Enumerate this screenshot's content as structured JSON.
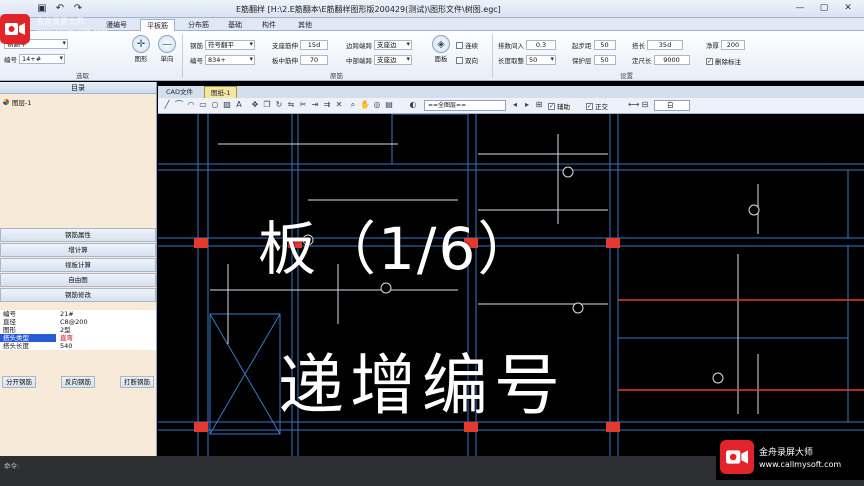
{
  "titlebar": {
    "title": "E筋翻样   [H:\\2.E筋翻本\\E筋翻样图形版200429(测试)\\图形文件\\树图.egc]",
    "win_min": "—",
    "win_max": "▢",
    "win_close": "✕"
  },
  "ribbon_tabs": [
    "漫编号",
    "平板筋",
    "分布筋",
    "基础",
    "构件",
    "其他"
  ],
  "ribbon": {
    "left_fields": [
      {
        "label": "",
        "value": "钢翻平"
      },
      {
        "label": "编号",
        "value": "14+#"
      }
    ],
    "left_buttons": [
      {
        "label": "图形"
      },
      {
        "label": "单向"
      }
    ],
    "mid_fields": [
      {
        "label": "钢筋",
        "value": "符号翻平"
      },
      {
        "label": "编号",
        "value": "834+"
      },
      {
        "label": "支座筋伸",
        "value": "15d"
      },
      {
        "label": "板中筋伸",
        "value": "70"
      },
      {
        "label": "边跨端跨",
        "value": "支座边"
      },
      {
        "label": "中部端跨",
        "value": "支座边"
      }
    ],
    "mid_checks": [
      {
        "label": "连续",
        "checked": false
      },
      {
        "label": "双向",
        "checked": false
      }
    ],
    "right_fields": [
      {
        "label": "排数间入",
        "value": "0.3"
      },
      {
        "label": "起步距",
        "value": "50"
      },
      {
        "label": "搭长",
        "value": "35d"
      },
      {
        "label": "净厚",
        "value": "200"
      },
      {
        "label": "长度取整",
        "value": "50"
      },
      {
        "label": "保护层",
        "value": "50"
      },
      {
        "label": "定尺长",
        "value": "9000"
      }
    ],
    "right_check": {
      "label": "删除标注",
      "checked": true
    },
    "group_labels": [
      "选取",
      "原筋",
      "设置"
    ],
    "round_button": "面板"
  },
  "left_panel": {
    "header": "目录",
    "tree_node": "图层-1",
    "actions": [
      "钢筋属性",
      "增计算",
      "视板计算",
      "自由图",
      "钢筋修改"
    ],
    "props": [
      {
        "key": "编号",
        "value": "21#"
      },
      {
        "key": "直径",
        "value": "C8@200"
      },
      {
        "key": "图形",
        "value": "2型"
      },
      {
        "key": "搭头类型",
        "value": "直弯"
      },
      {
        "key": "搭头长度",
        "value": "540"
      }
    ],
    "bottom_buttons": [
      "分开钢筋",
      "反向钢筋",
      "打断钢筋"
    ]
  },
  "doc_tabs": [
    "CAD文件",
    "图纸-1"
  ],
  "cad_toolbar": {
    "layer": "==全图层==",
    "checks": [
      {
        "label": "辅助",
        "checked": true
      },
      {
        "label": "正交",
        "checked": true
      }
    ],
    "color": "白"
  },
  "caption": {
    "line1": "板（1/6）",
    "line2": "递增编号"
  },
  "watermark": {
    "tl_text": "金舟录屏大师",
    "tl_url": "www.callmysoft.com",
    "br_name": "金舟录屏大师",
    "br_url": "www.callmysoft.com"
  },
  "status_text": "命令:"
}
